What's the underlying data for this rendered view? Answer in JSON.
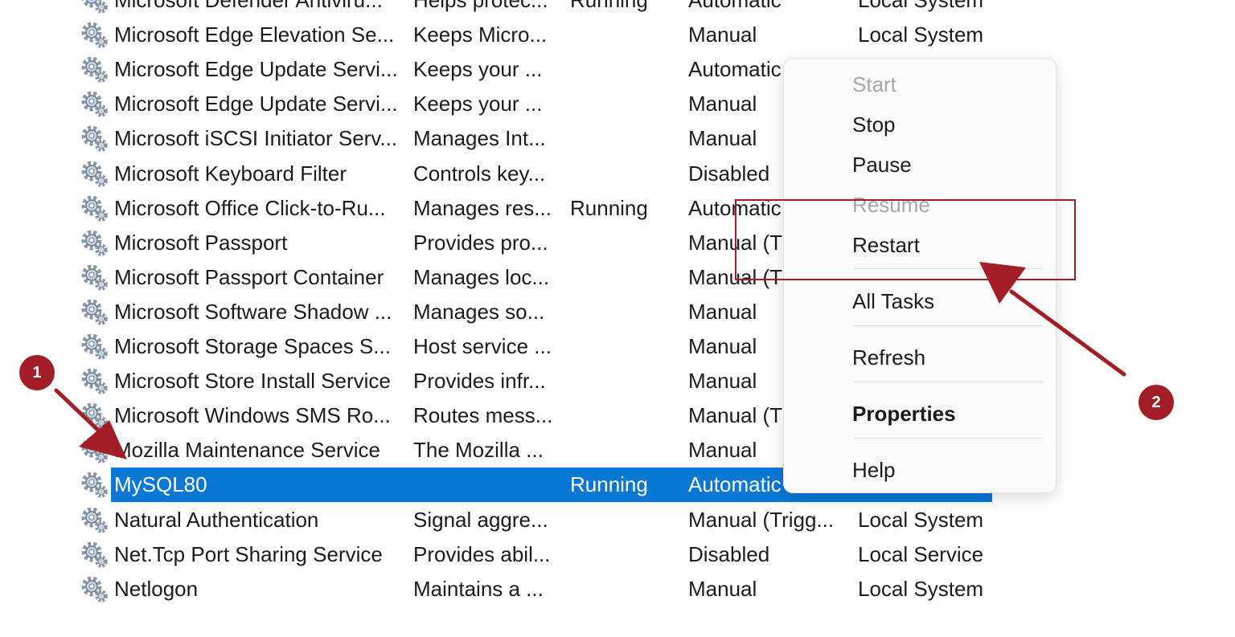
{
  "services": [
    {
      "name": "Microsoft Defender Antiviru...",
      "description": "Helps protec...",
      "status": "Running",
      "startup_type": "Automatic",
      "log_on_as": "Local System"
    },
    {
      "name": "Microsoft Edge Elevation Se...",
      "description": "Keeps Micro...",
      "status": "",
      "startup_type": "Manual",
      "log_on_as": "Local System"
    },
    {
      "name": "Microsoft Edge Update Servi...",
      "description": "Keeps your ...",
      "status": "",
      "startup_type": "Automatic",
      "log_on_as": ""
    },
    {
      "name": "Microsoft Edge Update Servi...",
      "description": "Keeps your ...",
      "status": "",
      "startup_type": "Manual",
      "log_on_as": ""
    },
    {
      "name": "Microsoft iSCSI Initiator Serv...",
      "description": "Manages Int...",
      "status": "",
      "startup_type": "Manual",
      "log_on_as": ""
    },
    {
      "name": "Microsoft Keyboard Filter",
      "description": "Controls key...",
      "status": "",
      "startup_type": "Disabled",
      "log_on_as": ""
    },
    {
      "name": "Microsoft Office Click-to-Ru...",
      "description": "Manages res...",
      "status": "Running",
      "startup_type": "Automatic",
      "log_on_as": ""
    },
    {
      "name": "Microsoft Passport",
      "description": "Provides pro...",
      "status": "",
      "startup_type": "Manual (T",
      "log_on_as": ""
    },
    {
      "name": "Microsoft Passport Container",
      "description": "Manages loc...",
      "status": "",
      "startup_type": "Manual (T",
      "log_on_as": ""
    },
    {
      "name": "Microsoft Software Shadow ...",
      "description": "Manages so...",
      "status": "",
      "startup_type": "Manual",
      "log_on_as": ""
    },
    {
      "name": "Microsoft Storage Spaces S...",
      "description": "Host service ...",
      "status": "",
      "startup_type": "Manual",
      "log_on_as": ""
    },
    {
      "name": "Microsoft Store Install Service",
      "description": "Provides infr...",
      "status": "",
      "startup_type": "Manual",
      "log_on_as": ""
    },
    {
      "name": "Microsoft Windows SMS Ro...",
      "description": "Routes mess...",
      "status": "",
      "startup_type": "Manual (T",
      "log_on_as": ""
    },
    {
      "name": "Mozilla Maintenance Service",
      "description": "The Mozilla ...",
      "status": "",
      "startup_type": "Manual",
      "log_on_as": ""
    },
    {
      "name": "MySQL80",
      "description": "",
      "status": "Running",
      "startup_type": "Automatic",
      "log_on_as": "",
      "selected": true
    },
    {
      "name": "Natural Authentication",
      "description": "Signal aggre...",
      "status": "",
      "startup_type": "Manual (Trigg...",
      "log_on_as": "Local System"
    },
    {
      "name": "Net.Tcp Port Sharing Service",
      "description": "Provides abil...",
      "status": "",
      "startup_type": "Disabled",
      "log_on_as": "Local Service"
    },
    {
      "name": "Netlogon",
      "description": "Maintains a ...",
      "status": "",
      "startup_type": "Manual",
      "log_on_as": "Local System"
    }
  ],
  "service_icon": "gear-service-icon",
  "context_menu": {
    "items": [
      {
        "label": "Start",
        "disabled": true
      },
      {
        "label": "Stop"
      },
      {
        "label": "Pause"
      },
      {
        "label": "Resume",
        "disabled": true
      },
      {
        "label": "Restart",
        "highlighted": true
      },
      {
        "label": "All Tasks"
      },
      {
        "label": "Refresh"
      },
      {
        "label": "Properties",
        "bold": true
      },
      {
        "label": "Help"
      }
    ]
  },
  "annotations": {
    "step1": "1",
    "step2": "2",
    "color": "#a31d27"
  },
  "colors": {
    "selection": "#0b77d4",
    "annotation": "#a31d27",
    "disabled_text": "#a7a7a7"
  }
}
